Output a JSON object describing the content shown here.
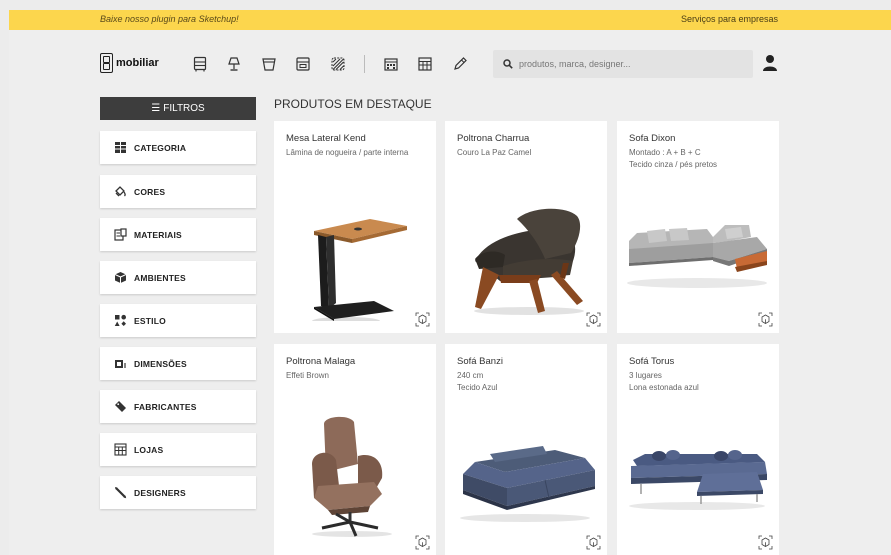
{
  "topbar": {
    "promo": "Baixe nosso plugin para Sketchup!",
    "business": "Serviços para empresas"
  },
  "header": {
    "logo_text": "mobiliar",
    "category_icons": [
      "cabinet-icon",
      "lamp-icon",
      "planter-icon",
      "storage-icon",
      "rug-icon",
      "building-icon",
      "store-icon",
      "pen-icon"
    ],
    "search_placeholder": "produtos, marca, designer..."
  },
  "sidebar": {
    "filters_label": "FILTROS",
    "items": [
      {
        "label": "CATEGORIA",
        "icon": "category-icon"
      },
      {
        "label": "CORES",
        "icon": "paint-icon"
      },
      {
        "label": "MATERIAIS",
        "icon": "materials-icon"
      },
      {
        "label": "AMBIENTES",
        "icon": "ambient-icon"
      },
      {
        "label": "ESTILO",
        "icon": "style-icon"
      },
      {
        "label": "DIMENSÕES",
        "icon": "dimensions-icon"
      },
      {
        "label": "FABRICANTES",
        "icon": "manufacturer-icon"
      },
      {
        "label": "LOJAS",
        "icon": "store-icon"
      },
      {
        "label": "DESIGNERS",
        "icon": "designer-icon"
      }
    ]
  },
  "main": {
    "section_title": "PRODUTOS EM DESTAQUE",
    "products": [
      {
        "name": "Mesa Lateral Kend",
        "lines": [
          "Lâmina de nogueira / parte interna"
        ]
      },
      {
        "name": "Poltrona Charrua",
        "lines": [
          "Couro La Paz Camel"
        ]
      },
      {
        "name": "Sofa Dixon",
        "lines": [
          "Montado : A + B + C",
          "Tecido cinza / pés pretos"
        ]
      },
      {
        "name": "Poltrona Malaga",
        "lines": [
          "Effeti Brown"
        ]
      },
      {
        "name": "Sofá Banzi",
        "lines": [
          "240 cm",
          "Tecido Azul"
        ]
      },
      {
        "name": "Sofá Torus",
        "lines": [
          "3 lugares",
          "Lona estonada azul"
        ]
      }
    ]
  },
  "colors": {
    "topbar": "#fcd64d",
    "filters_button": "#3d3d3d",
    "background": "#eeeeee"
  }
}
